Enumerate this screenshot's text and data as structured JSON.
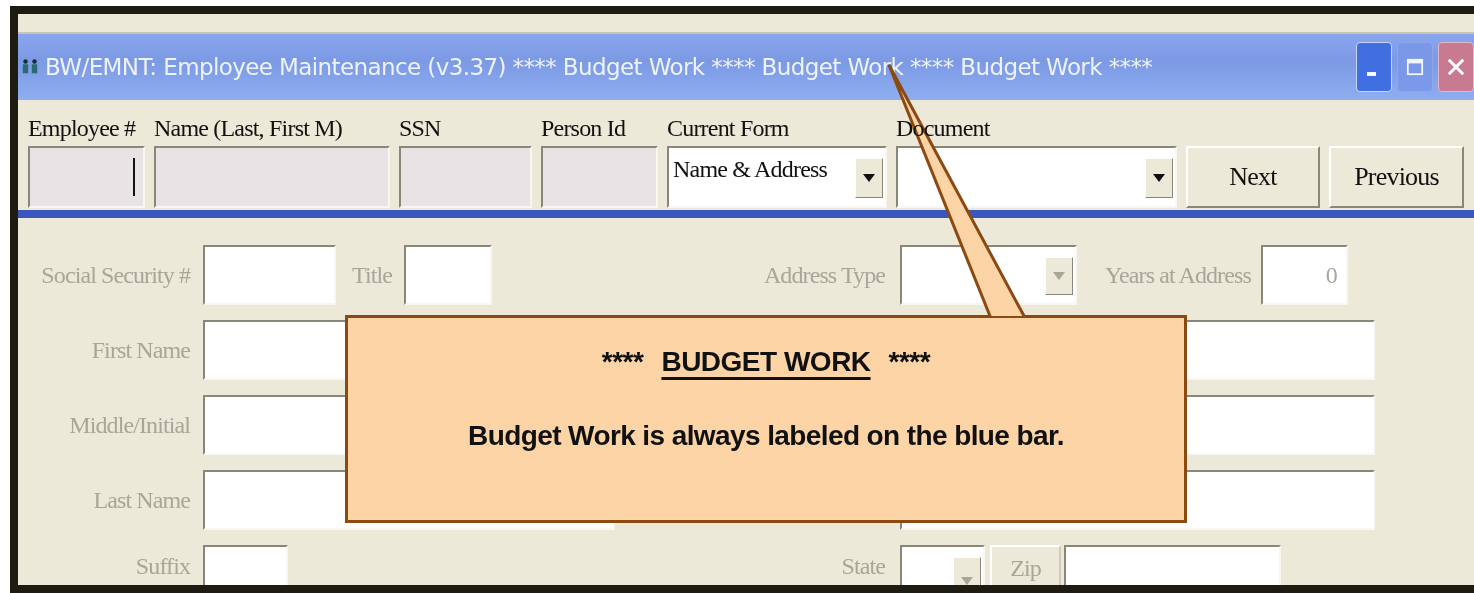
{
  "window": {
    "title": "BW/EMNT: Employee Maintenance (v3.37) **** Budget Work **** Budget Work **** Budget Work ****",
    "controls": [
      {
        "kind": "minimize",
        "disabled": false
      },
      {
        "kind": "maximize",
        "disabled": true
      },
      {
        "kind": "close",
        "disabled": false
      }
    ]
  },
  "header": {
    "employee_number": {
      "label": "Employee #",
      "focused": true
    },
    "name": {
      "label": "Name (Last, First M)"
    },
    "ssn": {
      "label": "SSN"
    },
    "person_id": {
      "label": "Person Id"
    },
    "current_form": {
      "label": "Current Form",
      "value": "Name & Address"
    },
    "document": {
      "label": "Document"
    },
    "buttons": [
      "Next",
      "Previous"
    ]
  },
  "form": {
    "disabled": true,
    "social_security": {
      "label": "Social Security #"
    },
    "title": {
      "label": "Title"
    },
    "address_type": {
      "label": "Address Type"
    },
    "years_at_address": {
      "label": "Years at Address",
      "value": "0"
    },
    "first_name": {
      "label": "First Name"
    },
    "middle_initial": {
      "label": "Middle/Initial"
    },
    "last_name": {
      "label": "Last Name"
    },
    "suffix": {
      "label": "Suffix"
    },
    "state": {
      "label": "State"
    },
    "zip": {
      "label": "Zip"
    }
  },
  "callout": {
    "heading": [
      {
        "text": "****",
        "underline": false
      },
      {
        "text": "BUDGET WORK",
        "underline": true
      },
      {
        "text": "****",
        "underline": false
      }
    ],
    "text": "Budget Work is always labeled on the blue bar."
  }
}
